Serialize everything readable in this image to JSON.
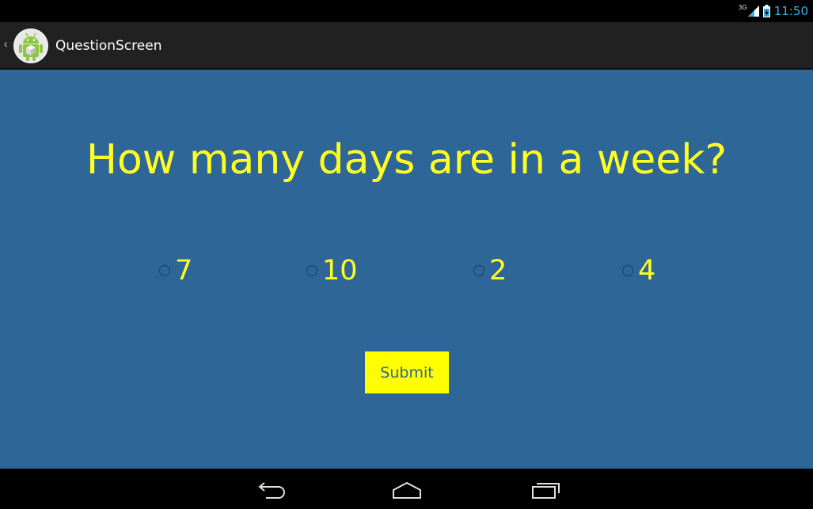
{
  "status_bar": {
    "network": "3G",
    "time": "11:50",
    "icons": [
      "signal-icon",
      "battery-icon"
    ]
  },
  "action_bar": {
    "title": "QuestionScreen",
    "icons": [
      "up-caret-icon",
      "android-app-icon"
    ]
  },
  "quiz": {
    "question": "How many days are in a week?",
    "answers": [
      {
        "label": "7",
        "selected": false
      },
      {
        "label": "10",
        "selected": false
      },
      {
        "label": "2",
        "selected": false
      },
      {
        "label": "4",
        "selected": false
      }
    ],
    "submit_label": "Submit"
  },
  "nav_bar": {
    "icons": [
      "back-icon",
      "home-icon",
      "recent-apps-icon"
    ]
  },
  "colors": {
    "background": "#2f6698",
    "text": "#ffff22",
    "button": "#ffff00",
    "accent": "#33b5e5"
  }
}
